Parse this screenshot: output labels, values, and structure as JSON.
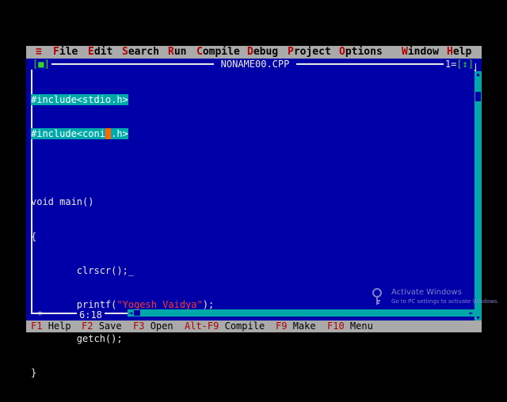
{
  "menu": {
    "system": "≡",
    "items": [
      {
        "hotkey": "F",
        "rest": "ile"
      },
      {
        "hotkey": "E",
        "rest": "dit"
      },
      {
        "hotkey": "S",
        "rest": "earch"
      },
      {
        "hotkey": "R",
        "rest": "un"
      },
      {
        "hotkey": "C",
        "rest": "ompile"
      },
      {
        "hotkey": "D",
        "rest": "ebug"
      },
      {
        "hotkey": "P",
        "rest": "roject"
      },
      {
        "hotkey": "O",
        "rest": "ptions"
      },
      {
        "hotkey": "W",
        "rest": "indow"
      },
      {
        "hotkey": "H",
        "rest": "elp"
      }
    ]
  },
  "window": {
    "close_box": "[■]",
    "filename": "NONAME00.CPP",
    "window_number": "1",
    "zoom_box": "[↕]",
    "position": "6:18",
    "modified_marker": "*"
  },
  "code": {
    "line1": "#include<stdio.h>",
    "line2": "#include<conio.h>",
    "line3": "",
    "line4": "void main()",
    "line5": "{",
    "line6_code": "clrscr();",
    "line6_caret": "_",
    "line7_pre": "printf(",
    "line7_str": "\"Yogesh Vaidya\"",
    "line7_post": ");",
    "line8": "getch();",
    "line9": "}"
  },
  "function_keys": [
    {
      "key": "F1",
      "label": "Help"
    },
    {
      "key": "F2",
      "label": "Save"
    },
    {
      "key": "F3",
      "label": "Open"
    },
    {
      "key": "Alt-F9",
      "label": "Compile"
    },
    {
      "key": "F9",
      "label": "Make"
    },
    {
      "key": "F10",
      "label": "Menu"
    }
  ],
  "watermark": {
    "title": "Activate Windows",
    "subtitle": "Go to PC settings to activate Windows."
  },
  "colors": {
    "editor_bg": "#0000a8",
    "menu_bg": "#aaaaaa",
    "hotkey": "#b00000",
    "string": "#ff3333",
    "highlight": "#00aaaa",
    "cursor": "#ff6600"
  }
}
